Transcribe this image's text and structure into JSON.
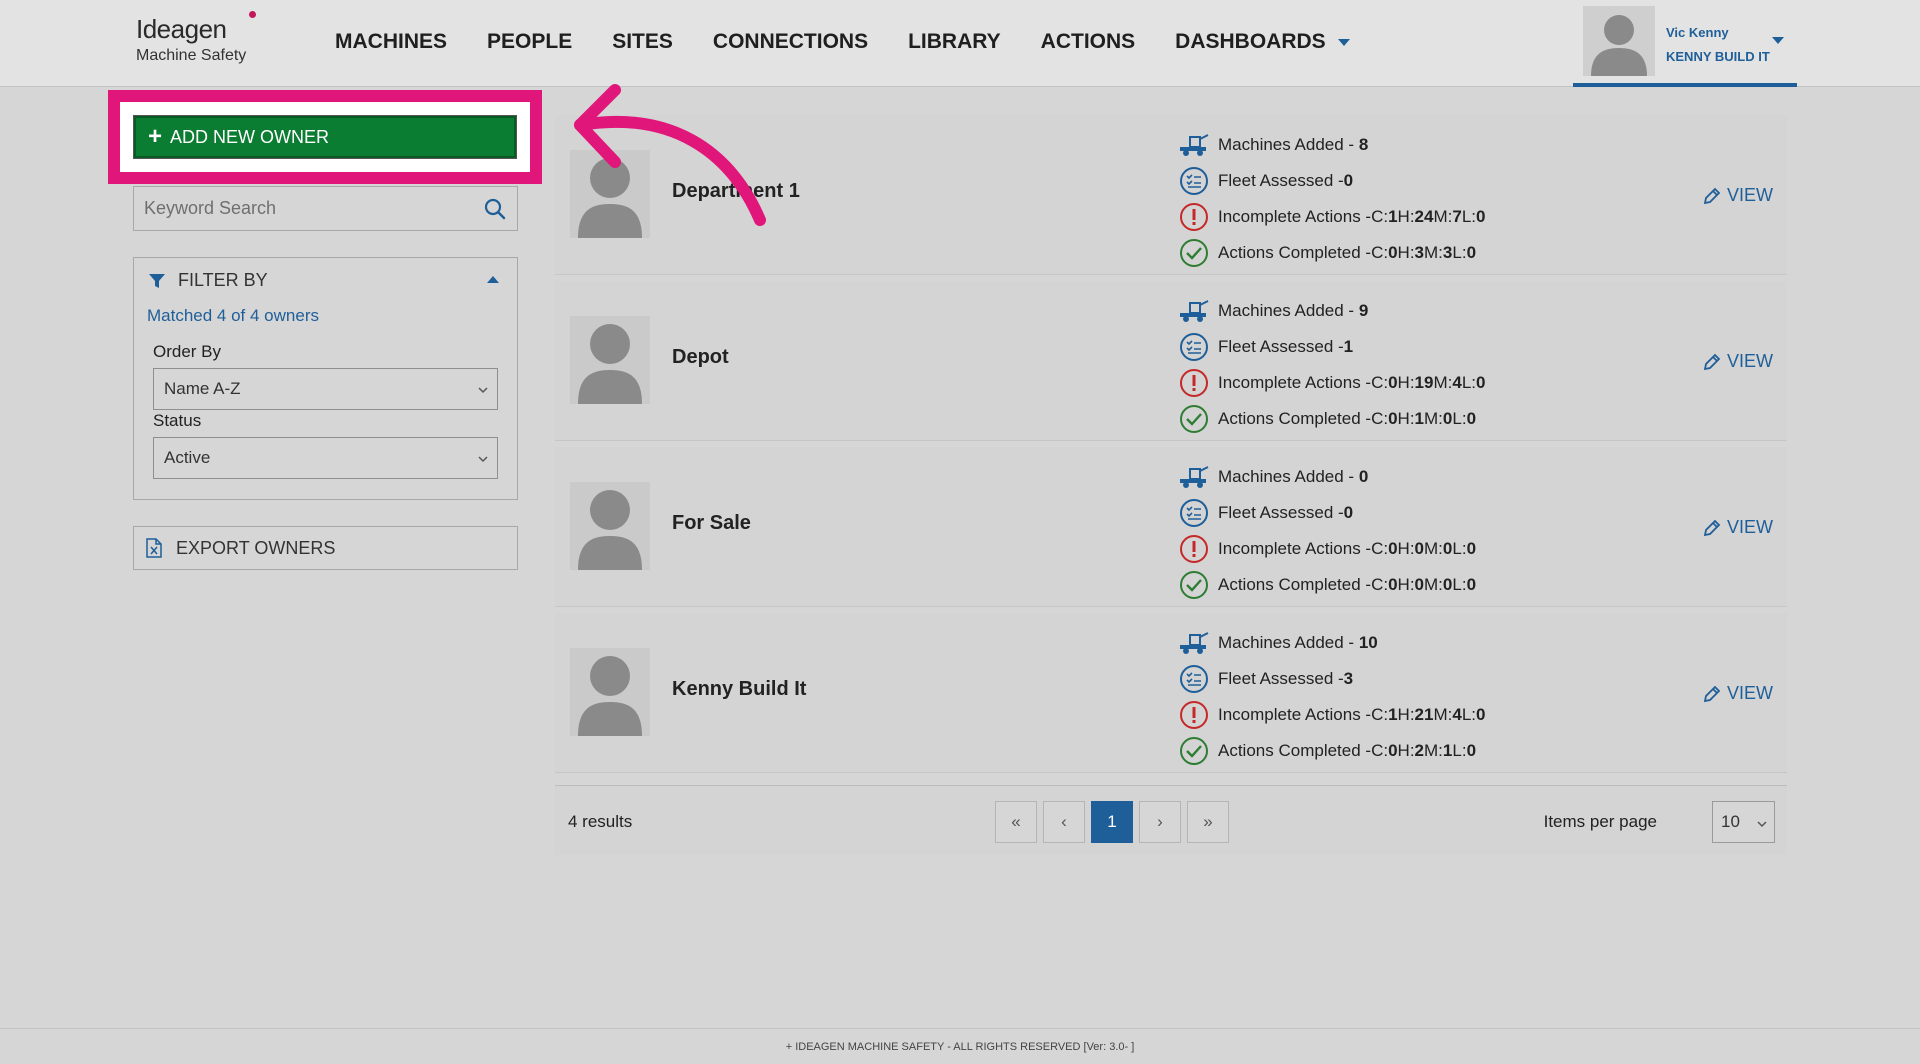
{
  "brand": {
    "name": "Ideagen",
    "product": "Machine Safety"
  },
  "nav": {
    "items": [
      {
        "label": "MACHINES"
      },
      {
        "label": "PEOPLE"
      },
      {
        "label": "SITES"
      },
      {
        "label": "CONNECTIONS"
      },
      {
        "label": "LIBRARY"
      },
      {
        "label": "ACTIONS"
      },
      {
        "label": "DASHBOARDS"
      }
    ]
  },
  "user": {
    "name": "Vic Kenny",
    "company": "KENNY BUILD IT"
  },
  "sidebar": {
    "add_button_label": "ADD NEW OWNER",
    "search_placeholder": "Keyword Search",
    "filter_title": "FILTER BY",
    "matched_text": "Matched 4 of 4 owners",
    "order_by_label": "Order By",
    "order_by_value": "Name A-Z",
    "status_label": "Status",
    "status_value": "Active",
    "export_label": "EXPORT OWNERS"
  },
  "owners": [
    {
      "name": "Department 1",
      "machines_label": "Machines Added - ",
      "machines": "8",
      "fleet_label": "Fleet Assessed - ",
      "fleet": "0",
      "incomplete_label": "Incomplete Actions - ",
      "incomplete": {
        "C": "1",
        "H": "24",
        "M": "7",
        "L": "0"
      },
      "completed_label": "Actions Completed - ",
      "completed": {
        "C": "0",
        "H": "3",
        "M": "3",
        "L": "0"
      },
      "view_label": "VIEW"
    },
    {
      "name": "Depot",
      "machines_label": "Machines Added - ",
      "machines": "9",
      "fleet_label": "Fleet Assessed - ",
      "fleet": "1",
      "incomplete_label": "Incomplete Actions - ",
      "incomplete": {
        "C": "0",
        "H": "19",
        "M": "4",
        "L": "0"
      },
      "completed_label": "Actions Completed - ",
      "completed": {
        "C": "0",
        "H": "1",
        "M": "0",
        "L": "0"
      },
      "view_label": "VIEW"
    },
    {
      "name": "For Sale",
      "machines_label": "Machines Added - ",
      "machines": "0",
      "fleet_label": "Fleet Assessed - ",
      "fleet": "0",
      "incomplete_label": "Incomplete Actions - ",
      "incomplete": {
        "C": "0",
        "H": "0",
        "M": "0",
        "L": "0"
      },
      "completed_label": "Actions Completed - ",
      "completed": {
        "C": "0",
        "H": "0",
        "M": "0",
        "L": "0"
      },
      "view_label": "VIEW"
    },
    {
      "name": "Kenny Build It",
      "machines_label": "Machines Added - ",
      "machines": "10",
      "fleet_label": "Fleet Assessed - ",
      "fleet": "3",
      "incomplete_label": "Incomplete Actions - ",
      "incomplete": {
        "C": "1",
        "H": "21",
        "M": "4",
        "L": "0"
      },
      "completed_label": "Actions Completed - ",
      "completed": {
        "C": "0",
        "H": "2",
        "M": "1",
        "L": "0"
      },
      "view_label": "VIEW"
    }
  ],
  "pagination": {
    "results": "4 results",
    "first": "«",
    "prev": "‹",
    "current": "1",
    "next": "›",
    "last": "»",
    "items_per_page_label": "Items per page",
    "items_per_page": "10"
  },
  "footer": {
    "text": "+ IDEAGEN MACHINE SAFETY - ALL RIGHTS RESERVED   [Ver: 3.0- ]"
  },
  "colors": {
    "accent": "#1f5f99",
    "primary_button": "#0b7d33",
    "highlight": "#e0167a",
    "alert": "#c62828",
    "success": "#2e7d32"
  }
}
